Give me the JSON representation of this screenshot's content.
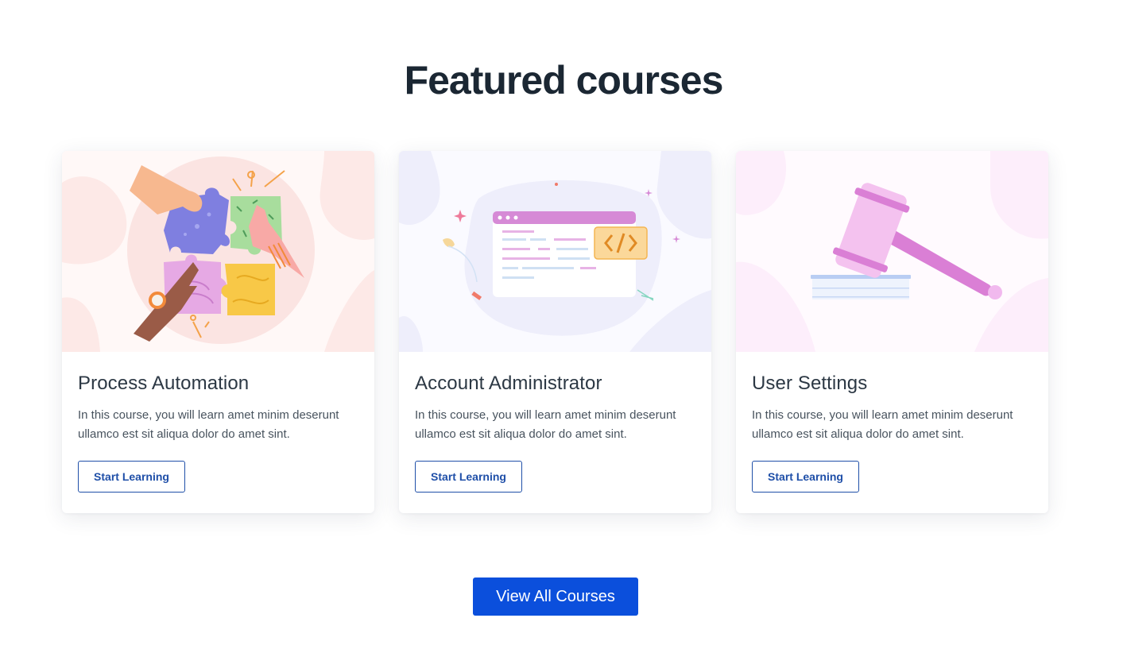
{
  "section": {
    "title": "Featured courses"
  },
  "courses": [
    {
      "title": "Process Automation",
      "description": "In this course, you will learn amet minim deserunt ullamco est sit aliqua dolor do amet sint.",
      "button_label": "Start Learning",
      "illustration": "puzzle-hands-illustration"
    },
    {
      "title": "Account Administrator",
      "description": "In this course, you will learn amet minim deserunt ullamco est sit aliqua dolor do amet sint.",
      "button_label": "Start Learning",
      "illustration": "code-window-illustration"
    },
    {
      "title": "User Settings",
      "description": "In this course, you will learn amet minim deserunt ullamco est sit aliqua dolor do amet sint.",
      "button_label": "Start Learning",
      "illustration": "gavel-illustration"
    }
  ],
  "view_all_label": "View All Courses",
  "colors": {
    "primary": "#0b4fdc",
    "outline_button": "#1f4fa8",
    "heading": "#1b2733"
  }
}
